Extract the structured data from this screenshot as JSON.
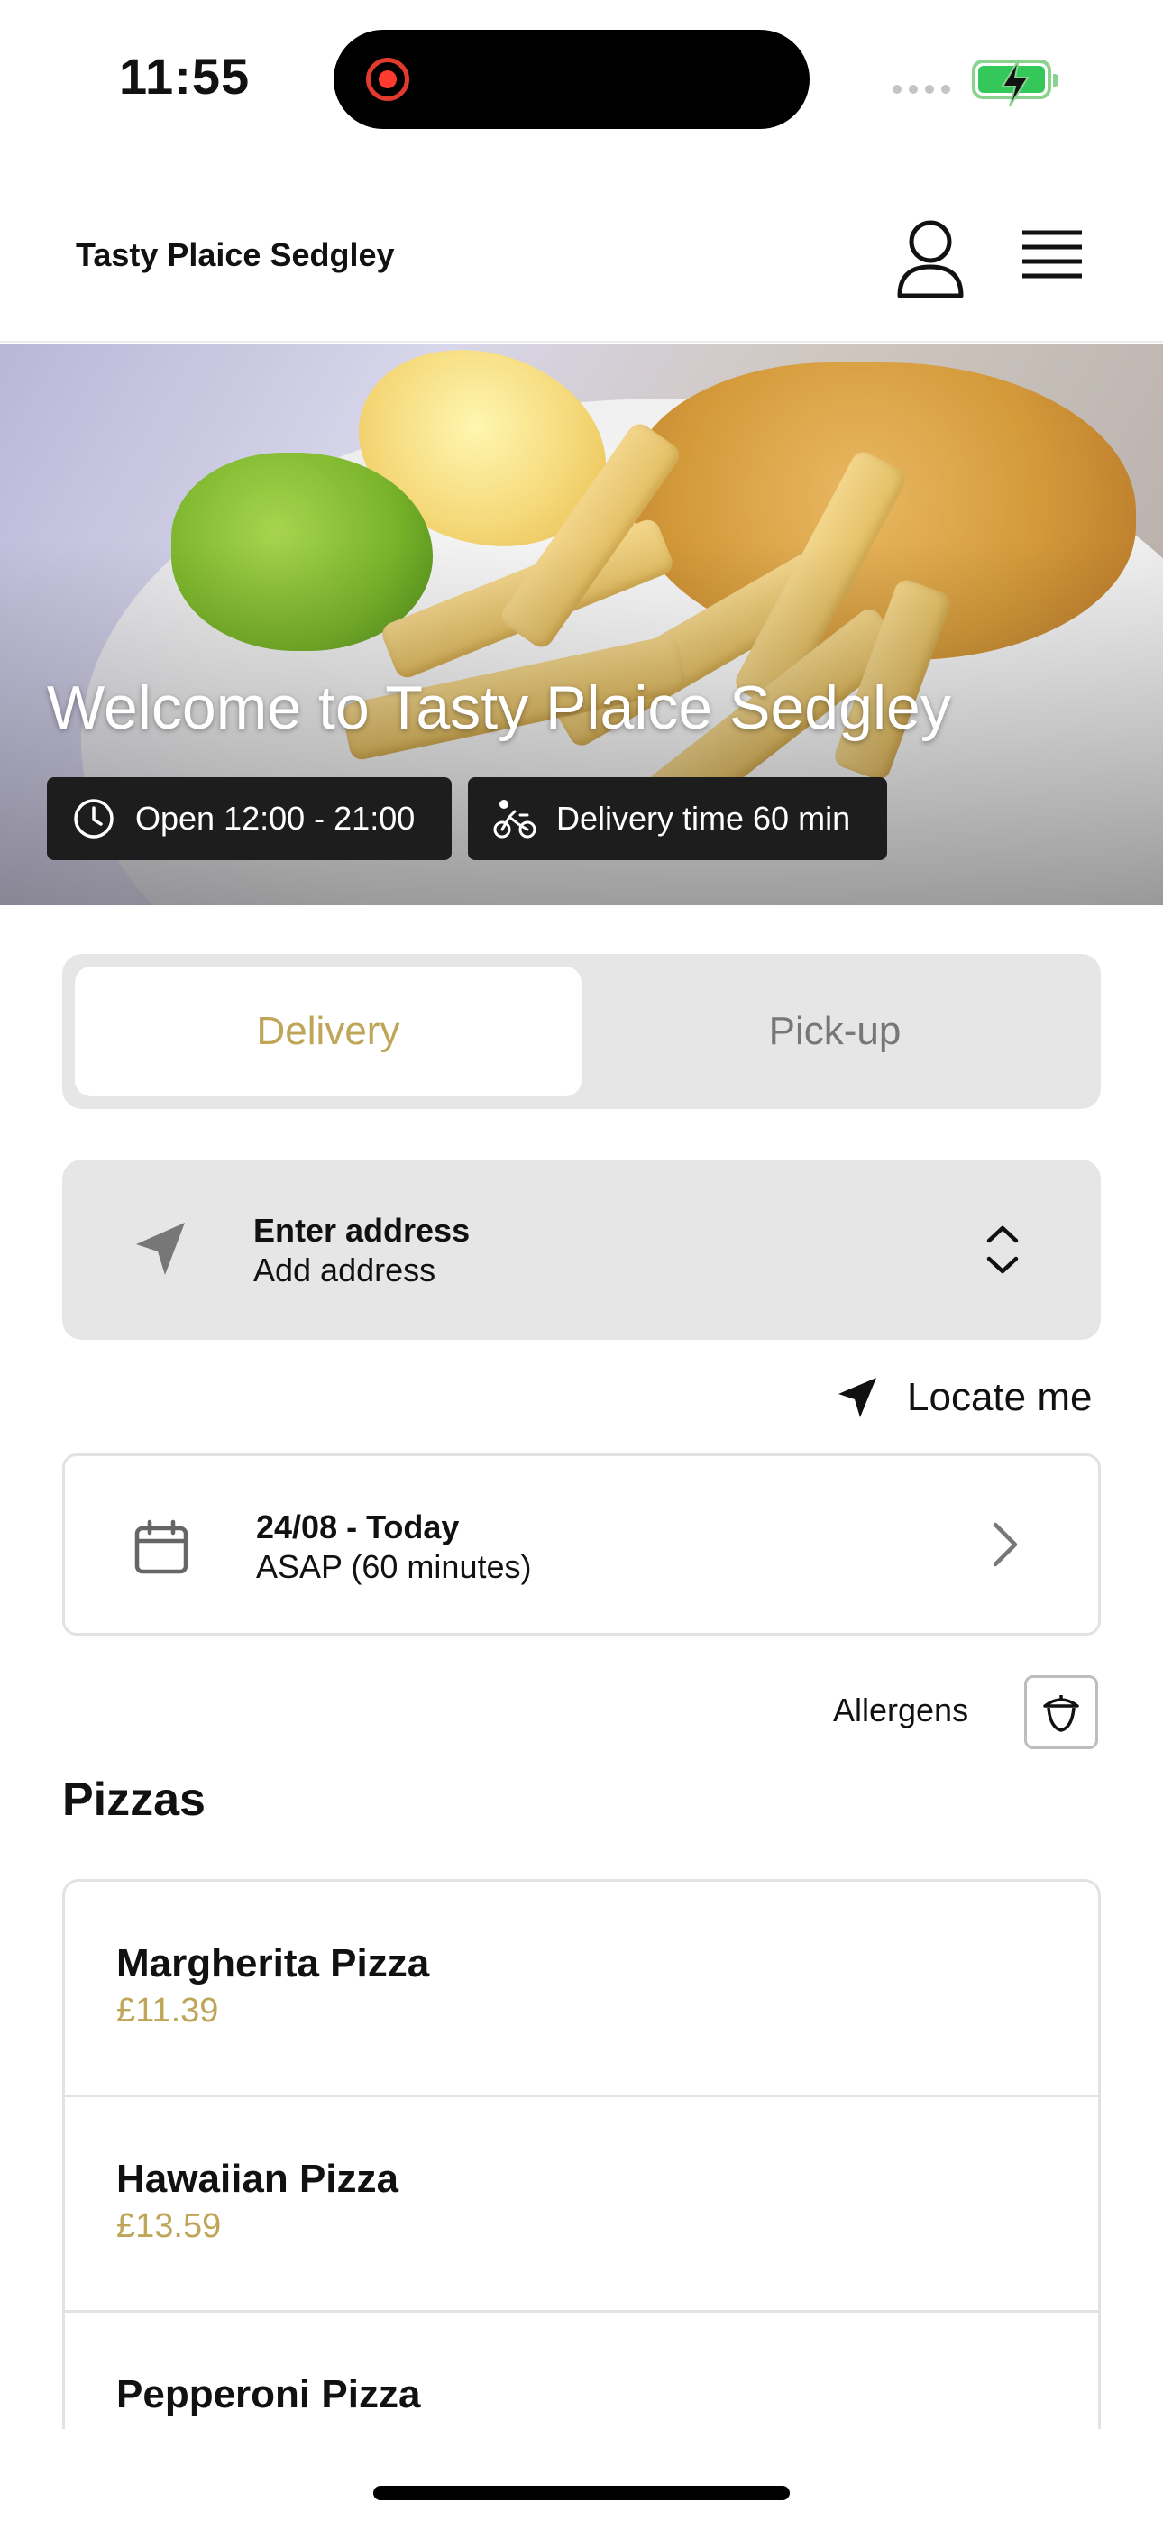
{
  "status_bar": {
    "time": "11:55"
  },
  "header": {
    "store_name": "Tasty Plaice Sedgley"
  },
  "hero": {
    "title": "Welcome to Tasty Plaice Sedgley",
    "hours": "Open 12:00 - 21:00",
    "delivery_time": "Delivery time 60 min"
  },
  "order_type": {
    "options": [
      "Delivery",
      "Pick-up"
    ],
    "selected": "Delivery"
  },
  "address": {
    "title": "Enter address",
    "subtitle": "Add address"
  },
  "locate": {
    "label": "Locate me"
  },
  "schedule": {
    "date": "24/08 - Today",
    "time": "ASAP (60 minutes)"
  },
  "allergens": {
    "label": "Allergens"
  },
  "menu": {
    "category": "Pizzas",
    "items": [
      {
        "name": "Margherita Pizza",
        "price": "£11.39"
      },
      {
        "name": "Hawaiian Pizza",
        "price": "£13.59"
      },
      {
        "name": "Pepperoni Pizza",
        "price": ""
      }
    ]
  },
  "colors": {
    "accent": "#bfa558",
    "pill_bg": "#1d1d1d",
    "field_bg": "#e6e6e6"
  }
}
